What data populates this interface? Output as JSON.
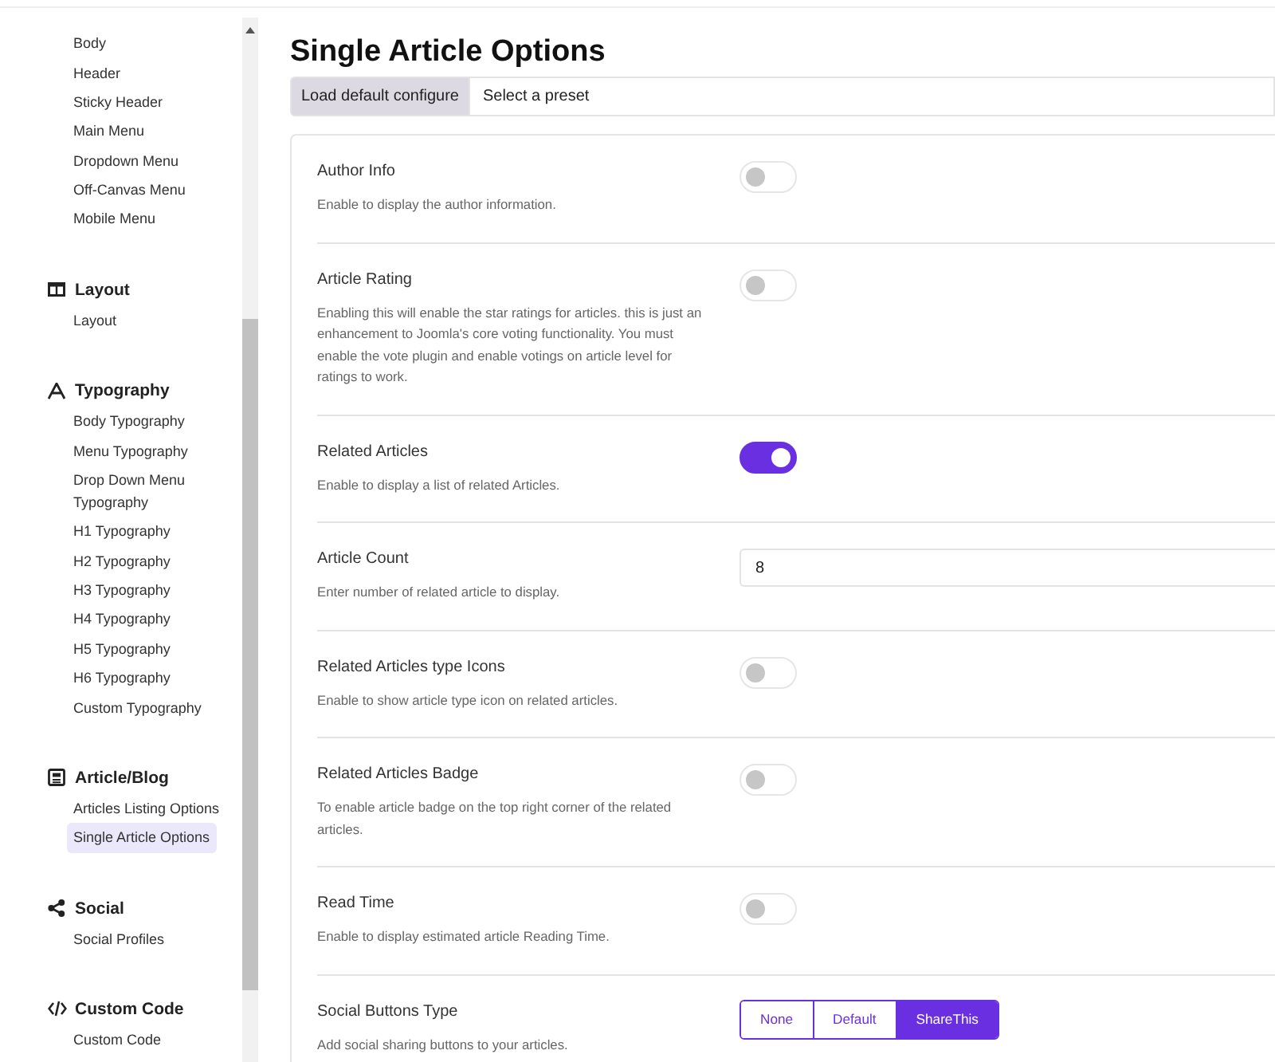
{
  "sidebar": {
    "groups": [
      {
        "items": [
          {
            "label": "Body",
            "selected": false
          },
          {
            "label": "Header",
            "selected": false
          },
          {
            "label": "Sticky Header",
            "selected": false
          },
          {
            "label": "Main Menu",
            "selected": false
          },
          {
            "label": "Dropdown Menu",
            "selected": false
          },
          {
            "label": "Off-Canvas Menu",
            "selected": false
          },
          {
            "label": "Mobile Menu",
            "selected": false
          }
        ]
      },
      {
        "heading": "Layout",
        "items": [
          {
            "label": "Layout",
            "selected": false
          }
        ]
      },
      {
        "heading": "Typography",
        "items": [
          {
            "label": "Body Typography",
            "selected": false
          },
          {
            "label": "Menu Typography",
            "selected": false
          },
          {
            "label": "Drop Down Menu Typography",
            "selected": false
          },
          {
            "label": "H1 Typography",
            "selected": false
          },
          {
            "label": "H2 Typography",
            "selected": false
          },
          {
            "label": "H3 Typography",
            "selected": false
          },
          {
            "label": "H4 Typography",
            "selected": false
          },
          {
            "label": "H5 Typography",
            "selected": false
          },
          {
            "label": "H6 Typography",
            "selected": false
          },
          {
            "label": "Custom Typography",
            "selected": false
          }
        ]
      },
      {
        "heading": "Article/Blog",
        "items": [
          {
            "label": "Articles Listing Options",
            "selected": false
          },
          {
            "label": "Single Article Options",
            "selected": true
          }
        ]
      },
      {
        "heading": "Social",
        "items": [
          {
            "label": "Social Profiles",
            "selected": false
          }
        ]
      },
      {
        "heading": "Custom Code",
        "items": [
          {
            "label": "Custom Code",
            "selected": false
          }
        ]
      }
    ]
  },
  "page_title": "Single Article Options",
  "preset_bar": {
    "button": "Load default configure",
    "placeholder": "Select a preset"
  },
  "settings": [
    {
      "kind": "toggle",
      "label": "Author Info",
      "description": "Enable to display the author information.",
      "on": false
    },
    {
      "kind": "toggle",
      "label": "Article Rating",
      "description": "Enabling this will enable the star ratings for articles. this is just an enhancement to Joomla's core voting functionality. You must enable the vote plugin and enable votings on article level for ratings to work.",
      "on": false
    },
    {
      "kind": "toggle",
      "label": "Related Articles",
      "description": "Enable to display a list of related Articles.",
      "on": true
    },
    {
      "kind": "number",
      "label": "Article Count",
      "description": "Enter number of related article to display.",
      "value": "8"
    },
    {
      "kind": "toggle",
      "label": "Related Articles type Icons",
      "description": "Enable to show article type icon on related articles.",
      "on": false
    },
    {
      "kind": "toggle",
      "label": "Related Articles Badge",
      "description": "To enable article badge on the top right corner of the related articles.",
      "on": false
    },
    {
      "kind": "toggle",
      "label": "Read Time",
      "description": "Enable to display estimated article Reading Time.",
      "on": false
    },
    {
      "kind": "segmented",
      "label": "Social Buttons Type",
      "description": "Add social sharing buttons to your articles.",
      "options": [
        {
          "label": "None",
          "selected": false
        },
        {
          "label": "Default",
          "selected": false
        },
        {
          "label": "ShareThis",
          "selected": true
        }
      ]
    }
  ]
}
